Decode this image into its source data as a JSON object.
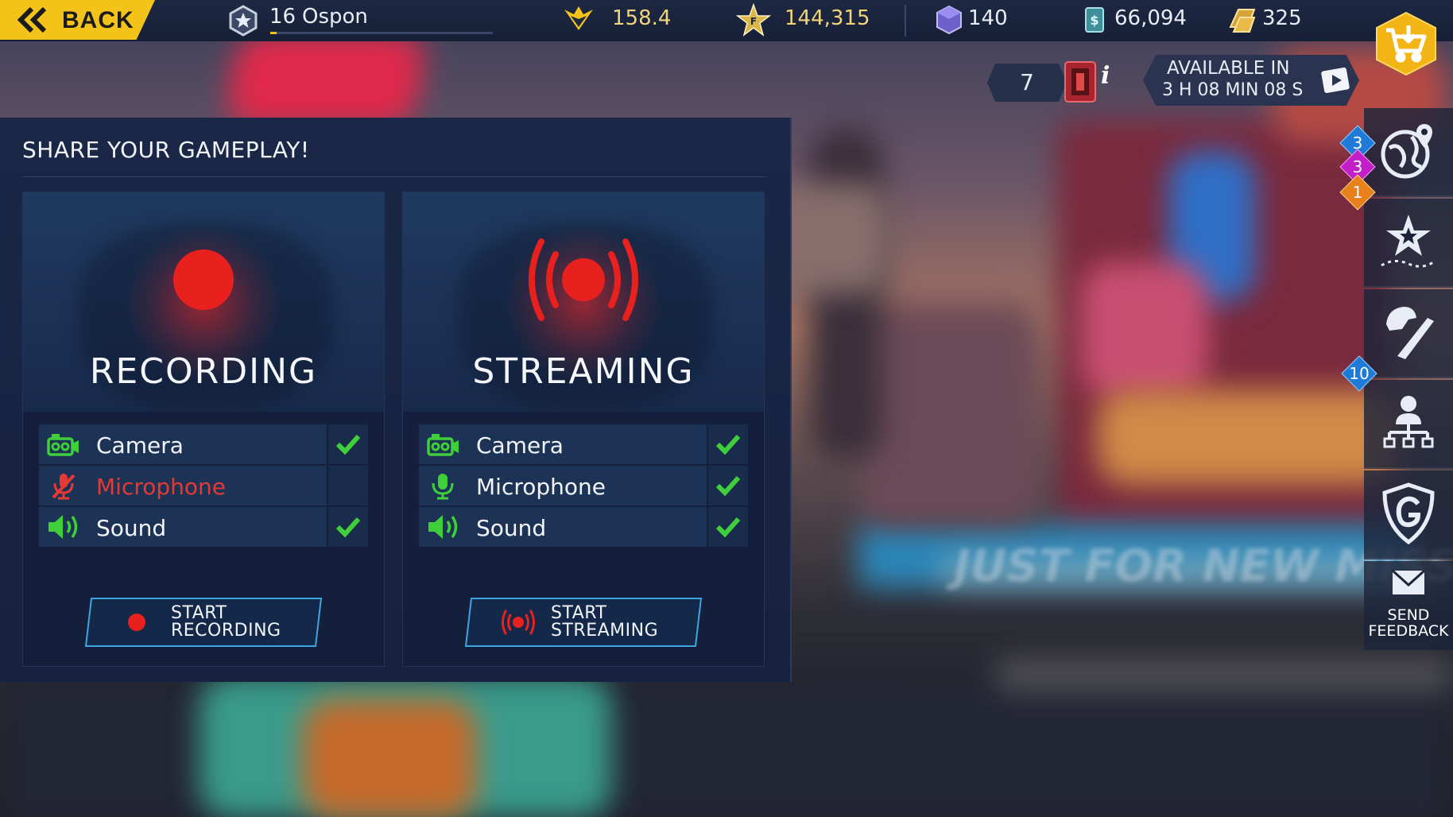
{
  "topbar": {
    "back_label": "BACK",
    "player": {
      "rank": "16",
      "name": "Ospon",
      "xp_progress": 0.03
    },
    "stats": [
      {
        "icon": "wings-rating-icon",
        "value": "158.4"
      },
      {
        "icon": "faction-star-icon",
        "value": "144,315"
      },
      {
        "icon": "gem-crate-icon",
        "value": "140"
      },
      {
        "icon": "cash-stack-icon",
        "value": "66,094"
      },
      {
        "icon": "gold-bars-icon",
        "value": "325"
      }
    ],
    "shop_icon": "shopping-cart-icon"
  },
  "offer": {
    "count": "7",
    "info": "i",
    "timer_line1": "AVAILABLE IN",
    "timer_line2": "3 H 08 MIN 08 S"
  },
  "sidebar": {
    "badges": {
      "blue": "3",
      "magenta": "3",
      "orange": "1",
      "weapons": "10"
    },
    "feedback_label": "SEND FEEDBACK"
  },
  "share_panel": {
    "title": "SHARE YOUR GAMEPLAY!",
    "cards": [
      {
        "title": "RECORDING",
        "options": [
          {
            "label": "Camera",
            "enabled": true
          },
          {
            "label": "Microphone",
            "enabled": false
          },
          {
            "label": "Sound",
            "enabled": true
          }
        ],
        "button_line1": "START",
        "button_line2": "RECORDING"
      },
      {
        "title": "STREAMING",
        "options": [
          {
            "label": "Camera",
            "enabled": true
          },
          {
            "label": "Microphone",
            "enabled": true
          },
          {
            "label": "Sound",
            "enabled": true
          }
        ],
        "button_line1": "START",
        "button_line2": "STREAMING"
      }
    ]
  },
  "background": {
    "slogan": "JUST FOR NEW MISS"
  },
  "colors": {
    "accent_yellow": "#f3c31a",
    "record_red": "#e8201e",
    "check_green": "#3fcf3a",
    "panel_bg": "#1a2746"
  }
}
